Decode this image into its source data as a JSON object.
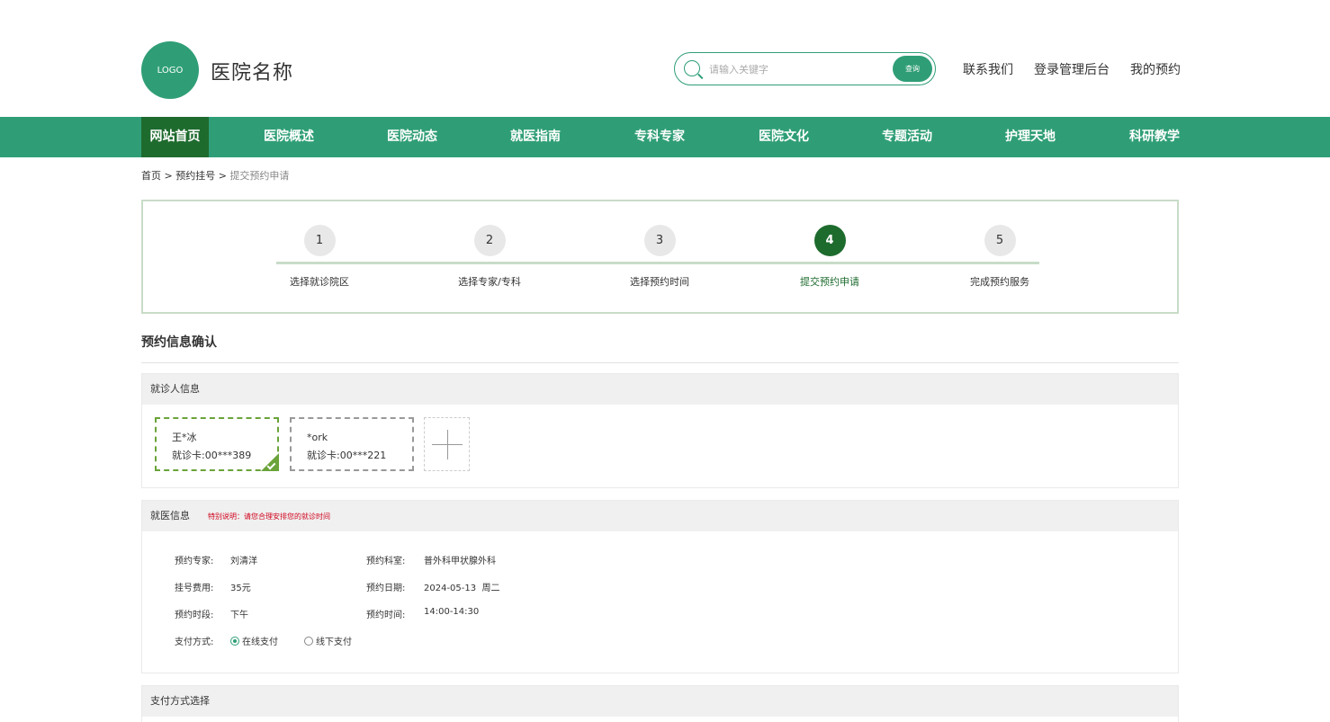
{
  "header": {
    "logo_text": "LOGO",
    "hospital_name": "医院名称",
    "search_placeholder": "请输入关键字",
    "search_button": "查询",
    "links": [
      "联系我们",
      "登录管理后台",
      "我的预约"
    ]
  },
  "nav": {
    "items": [
      "网站首页",
      "医院概述",
      "医院动态",
      "就医指南",
      "专科专家",
      "医院文化",
      "专题活动",
      "护理天地",
      "科研教学"
    ],
    "active_index": 0
  },
  "breadcrumb": {
    "home": "首页",
    "sep1": ">",
    "level2": "预约挂号",
    "sep2": ">",
    "current": "提交预约申请"
  },
  "steps": [
    {
      "num": "1",
      "label": "选择就诊院区"
    },
    {
      "num": "2",
      "label": "选择专家/专科"
    },
    {
      "num": "3",
      "label": "选择预约时间"
    },
    {
      "num": "4",
      "label": "提交预约申请"
    },
    {
      "num": "5",
      "label": "完成预约服务"
    }
  ],
  "active_step": 4,
  "section_title": "预约信息确认",
  "patients": {
    "title": "就诊人信息",
    "cards": [
      {
        "name": "王*冰",
        "card": "就诊卡:00***389",
        "selected": true
      },
      {
        "name": "*ork",
        "card": "就诊卡:00***221",
        "selected": false
      }
    ]
  },
  "visit": {
    "title": "就医信息",
    "note": "特别说明：请您合理安排您的就诊时间",
    "expert_label": "预约专家:",
    "expert": "刘清洋",
    "dept_label": "预约科室:",
    "dept": "普外科甲状腺外科",
    "fee_label": "挂号费用:",
    "fee": "35元",
    "date_label": "预约日期:",
    "date": "2024-05-13  周二",
    "period_label": "预约时段:",
    "period": "下午",
    "time_label": "预约时间:",
    "time": "14:00-14:30",
    "pay_label": "支付方式:",
    "pay_online": "在线支付",
    "pay_offline": "线下支付"
  },
  "payment": {
    "title": "支付方式选择"
  },
  "colors": {
    "brand": "#2f9e76",
    "active": "#1e6b2e",
    "selected_border": "#6aa33a",
    "note": "#d0021b"
  }
}
